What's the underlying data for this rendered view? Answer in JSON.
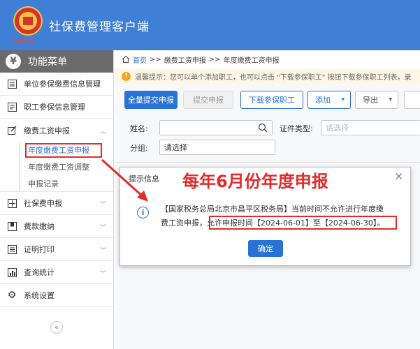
{
  "header": {
    "title": "社保费管理客户端",
    "emblem_text": "中国税务"
  },
  "sidebar": {
    "heading": "功能菜单",
    "heading_icon": "yen-icon",
    "items": [
      {
        "label": "单位参保缴费信息管理",
        "icon": "grid-icon"
      },
      {
        "label": "职工参保信息管理",
        "icon": "list-icon"
      },
      {
        "label": "缴费工资申报",
        "icon": "edit-icon",
        "expanded": true
      },
      {
        "label": "社保费申报",
        "icon": "doc-icon"
      },
      {
        "label": "费款缴纳",
        "icon": "bookmark-icon"
      },
      {
        "label": "证明打印",
        "icon": "print-icon"
      },
      {
        "label": "查询统计",
        "icon": "chart-icon"
      },
      {
        "label": "系统设置",
        "icon": "gear-icon"
      }
    ],
    "sub_items": [
      {
        "label": "年度缴费工资申报",
        "active": true
      },
      {
        "label": "年度缴费工资调整",
        "active": false
      },
      {
        "label": "申报记录",
        "active": false
      }
    ],
    "collapse_symbol": "«"
  },
  "breadcrumb": {
    "home": "首页",
    "sep": ">>",
    "part1": "缴费工资申报",
    "part2": "年度缴费工资申报"
  },
  "tip": {
    "text": "温馨提示：您可以单个添加职工，也可以点击 \"下载参保职工\" 按钮下载参保职工列表，录"
  },
  "toolbar": {
    "submit_all": "全量提交申报",
    "submit": "提交申报",
    "download": "下载参保职工",
    "add": "添加",
    "export": "导出"
  },
  "form": {
    "name_label": "姓名:",
    "name_value": "",
    "cert_type_label": "证件类型:",
    "cert_type_placeholder": "请选择",
    "group_label": "分组:",
    "group_placeholder": "请选择"
  },
  "dialog": {
    "title": "提示信息",
    "banner": "每年6月份年度申报",
    "message_line1": "【国家税务总局北京市昌平区税务局】当前时间不允许进行年度缴",
    "message_line2": "费工资申报，允许申报时间【2024-06-01】至【2024-06-30】。",
    "confirm": "确定"
  },
  "colors": {
    "header_blue": "#3f7fd6",
    "primary": "#2a73d6",
    "annotation_red": "#e32b2b"
  }
}
